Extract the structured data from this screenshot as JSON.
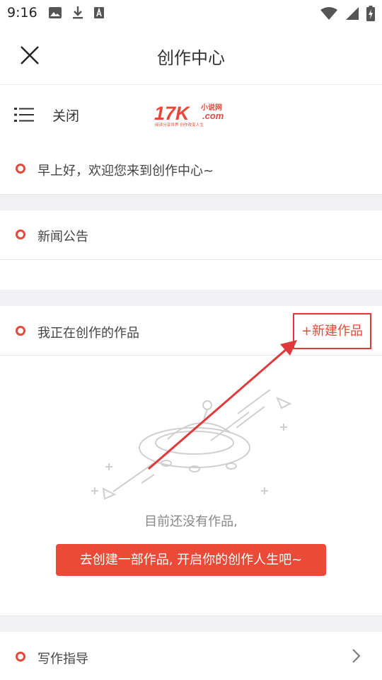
{
  "status_bar": {
    "time": "9:16",
    "left_icons": [
      "image-icon",
      "download-icon",
      "font-icon"
    ],
    "right_icons": [
      "wifi-icon",
      "signal-icon",
      "battery-icon"
    ]
  },
  "nav": {
    "title": "创作中心",
    "close_icon": "close-icon"
  },
  "site_header": {
    "menu_icon": "menu-icon",
    "close_label": "关闭",
    "logo": {
      "brand": "17K",
      "sub1": "小说网",
      "sub2": ".com",
      "tagline": "阅读分享世界  创作改变人生"
    }
  },
  "greeting": {
    "label": "早上好，欢迎您来到创作中心~"
  },
  "news": {
    "label": "新闻公告"
  },
  "works": {
    "label": "我正在创作的作品",
    "new_button": "+新建作品",
    "empty_text": "目前还没有作品,",
    "cta": "去创建一部作品, 开启你的创作人生吧~"
  },
  "guide": {
    "label": "写作指导",
    "chevron": "chevron-right-icon"
  },
  "colors": {
    "accent": "#e8483a",
    "annotation": "#e0393b",
    "gap": "#f2f2f4"
  }
}
